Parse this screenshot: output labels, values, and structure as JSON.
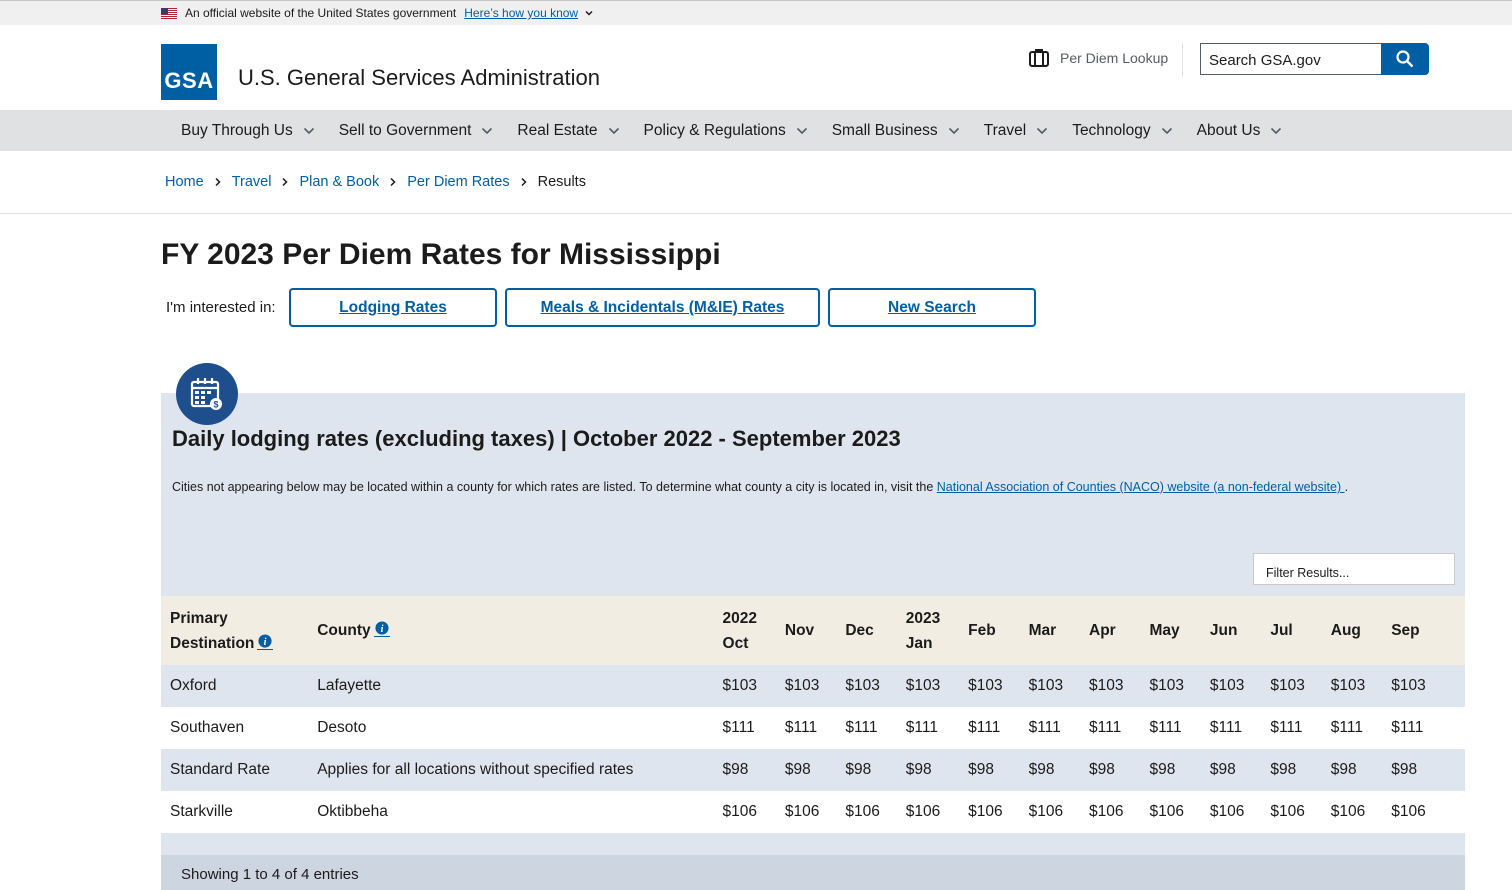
{
  "banner": {
    "text": "An official website of the United States government",
    "link": "Here’s how you know"
  },
  "header": {
    "logo_text": "GSA",
    "title": "U.S. General Services Administration",
    "lookup_label": "Per Diem Lookup",
    "search_placeholder": "Search GSA.gov"
  },
  "nav": [
    {
      "label": "Buy Through Us"
    },
    {
      "label": "Sell to Government"
    },
    {
      "label": "Real Estate"
    },
    {
      "label": "Policy & Regulations"
    },
    {
      "label": "Small Business"
    },
    {
      "label": "Travel"
    },
    {
      "label": "Technology"
    },
    {
      "label": "About Us"
    }
  ],
  "breadcrumb": {
    "home": "Home",
    "travel": "Travel",
    "plan": "Plan & Book",
    "perdiem": "Per Diem Rates",
    "current": "Results"
  },
  "page": {
    "title": "FY 2023 Per Diem Rates for Mississippi",
    "interested_label": "I'm interested in:",
    "btn_lodging": "Lodging Rates",
    "btn_meals": "Meals & Incidentals (M&IE) Rates",
    "btn_new": "New Search"
  },
  "panel": {
    "title": "Daily lodging rates (excluding taxes) | October 2022 - September 2023",
    "note_text": "Cities not appearing below may be located within a county for which rates are listed. To determine what county a city is located in, visit the ",
    "note_link": "National Association of Counties (NACO) website (a non-federal website) ",
    "note_end": ".",
    "filter_placeholder": "Filter Results..."
  },
  "table": {
    "headers": {
      "destination_line1": "Primary",
      "destination_line2": "Destination",
      "county": "County",
      "oct_year": "2022",
      "oct": "Oct",
      "nov": "Nov",
      "dec": "Dec",
      "jan_year": "2023",
      "jan": "Jan",
      "feb": "Feb",
      "mar": "Mar",
      "apr": "Apr",
      "may": "May",
      "jun": "Jun",
      "jul": "Jul",
      "aug": "Aug",
      "sep": "Sep"
    },
    "rows": [
      {
        "destination": "Oxford",
        "county": "Lafayette",
        "rates": [
          "$103",
          "$103",
          "$103",
          "$103",
          "$103",
          "$103",
          "$103",
          "$103",
          "$103",
          "$103",
          "$103",
          "$103"
        ]
      },
      {
        "destination": "Southaven",
        "county": "Desoto",
        "rates": [
          "$111",
          "$111",
          "$111",
          "$111",
          "$111",
          "$111",
          "$111",
          "$111",
          "$111",
          "$111",
          "$111",
          "$111"
        ]
      },
      {
        "destination": "Standard Rate",
        "county": "Applies for all locations without specified rates",
        "rates": [
          "$98",
          "$98",
          "$98",
          "$98",
          "$98",
          "$98",
          "$98",
          "$98",
          "$98",
          "$98",
          "$98",
          "$98"
        ]
      },
      {
        "destination": "Starkville",
        "county": "Oktibbeha",
        "rates": [
          "$106",
          "$106",
          "$106",
          "$106",
          "$106",
          "$106",
          "$106",
          "$106",
          "$106",
          "$106",
          "$106",
          "$106"
        ]
      }
    ],
    "footer": "Showing 1 to 4 of 4 entries"
  },
  "colors": {
    "primary": "#005ea2",
    "nav_bg": "#dfe1e2",
    "panel_bg": "#dfe5ee",
    "header_row_bg": "#f1ede2",
    "icon_circle": "#1f4e8c"
  }
}
